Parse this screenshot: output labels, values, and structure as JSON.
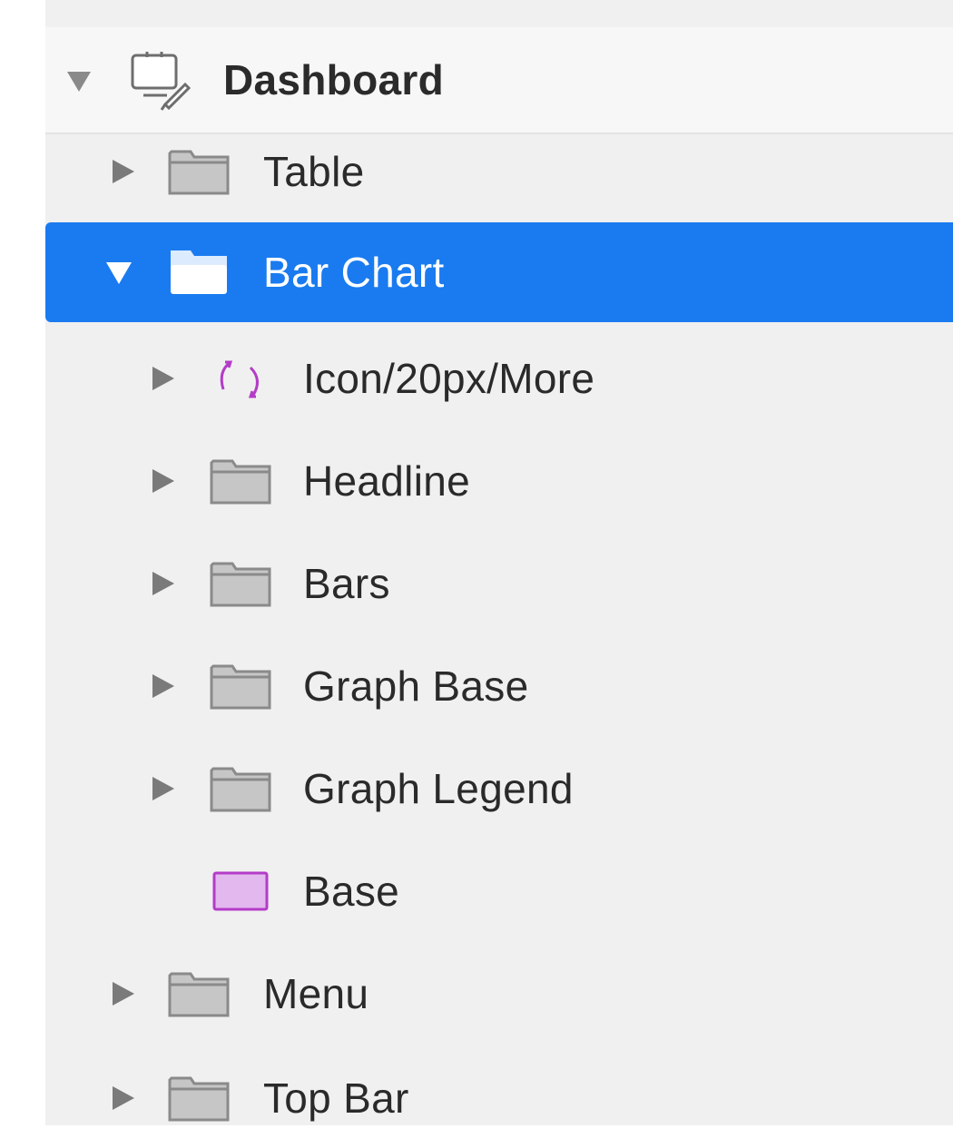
{
  "layers": {
    "page": {
      "label": "Dashboard",
      "expanded": true,
      "icon": "artboard-icon"
    },
    "items": [
      {
        "label": "Table",
        "icon": "folder-icon",
        "expanded": false
      },
      {
        "label": "Bar Chart",
        "icon": "folder-open-icon",
        "expanded": true,
        "selected": true
      },
      {
        "label": "Icon/20px/More",
        "icon": "symbol-icon",
        "expanded": false
      },
      {
        "label": "Headline",
        "icon": "folder-icon",
        "expanded": false
      },
      {
        "label": "Bars",
        "icon": "folder-icon",
        "expanded": false
      },
      {
        "label": "Graph Base",
        "icon": "folder-icon",
        "expanded": false
      },
      {
        "label": "Graph Legend",
        "icon": "folder-icon",
        "expanded": false
      },
      {
        "label": "Base",
        "icon": "rectangle-shape-icon"
      },
      {
        "label": "Menu",
        "icon": "folder-icon",
        "expanded": false
      },
      {
        "label": "Top Bar",
        "icon": "folder-icon",
        "expanded": false
      }
    ]
  },
  "colors": {
    "selection": "#1a7bf0",
    "symbol_accent": "#b43cc8",
    "shape_fill": "#e2b8ee",
    "shape_stroke": "#b43cc8",
    "folder_fill": "#c6c6c6",
    "folder_stroke": "#8a8a8a"
  }
}
